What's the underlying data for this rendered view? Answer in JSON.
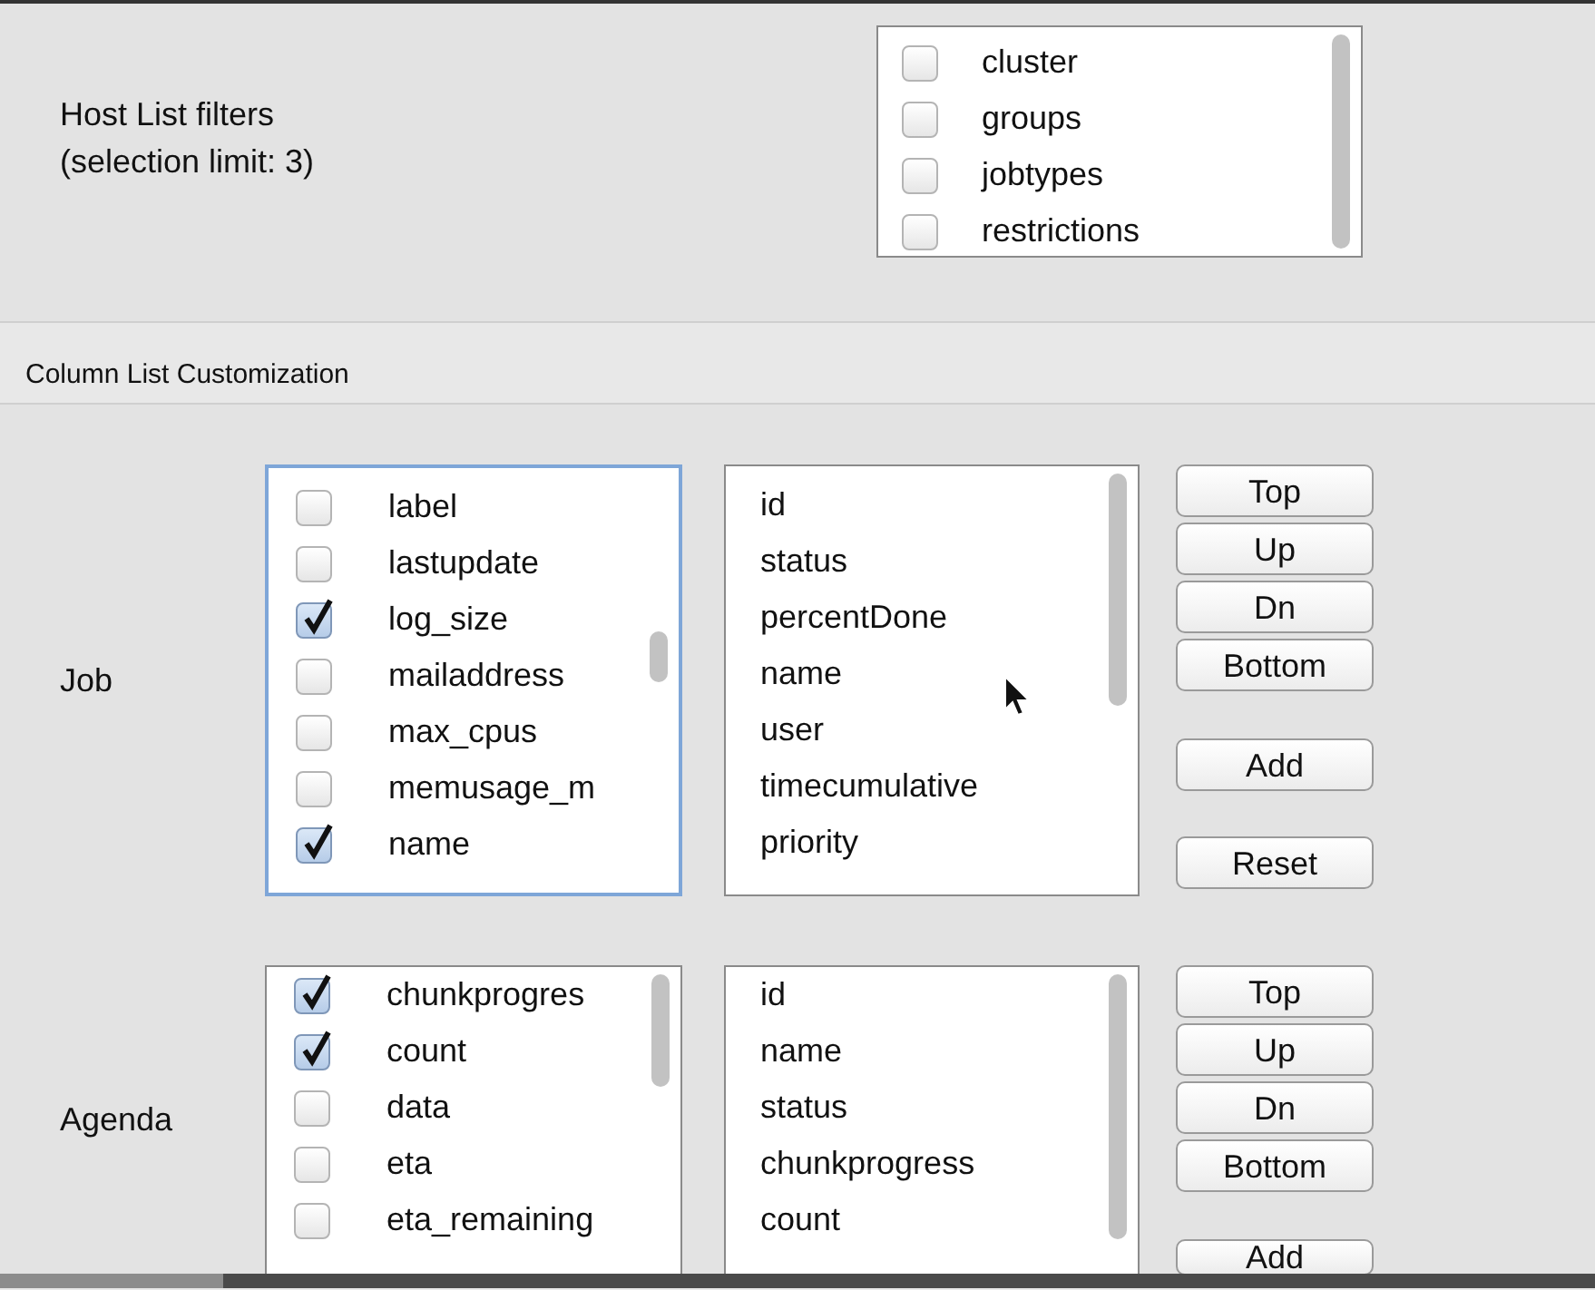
{
  "host_filters": {
    "label_lines": [
      "Host List filters",
      "(selection limit: 3)"
    ],
    "items": [
      {
        "label": "cluster",
        "checked": false
      },
      {
        "label": "groups",
        "checked": false
      },
      {
        "label": "jobtypes",
        "checked": false
      },
      {
        "label": "restrictions",
        "checked": false
      }
    ]
  },
  "column_section": {
    "title": "Column List Customization",
    "groups": [
      {
        "label": "Job",
        "focused": true,
        "available": [
          {
            "label": "label",
            "checked": false
          },
          {
            "label": "lastupdate",
            "checked": false
          },
          {
            "label": "log_size",
            "checked": true
          },
          {
            "label": "mailaddress",
            "checked": false
          },
          {
            "label": "max_cpus",
            "checked": false
          },
          {
            "label": "memusage_m",
            "checked": false
          },
          {
            "label": "name",
            "checked": true
          }
        ],
        "columns": [
          "id",
          "status",
          "percentDone",
          "name",
          "user",
          "timecumulative",
          "priority"
        ],
        "move_buttons": [
          "Top",
          "Up",
          "Dn",
          "Bottom"
        ],
        "edit_buttons": [
          "Add",
          "Reset"
        ]
      },
      {
        "label": "Agenda",
        "focused": false,
        "available": [
          {
            "label": "chunkprogres",
            "checked": true
          },
          {
            "label": "count",
            "checked": true
          },
          {
            "label": "data",
            "checked": false
          },
          {
            "label": "eta",
            "checked": false
          },
          {
            "label": "eta_remaining",
            "checked": false
          }
        ],
        "columns": [
          "id",
          "name",
          "status",
          "chunkprogress",
          "count"
        ],
        "move_buttons": [
          "Top",
          "Up",
          "Dn",
          "Bottom"
        ],
        "edit_buttons": [
          "Add"
        ]
      }
    ]
  }
}
